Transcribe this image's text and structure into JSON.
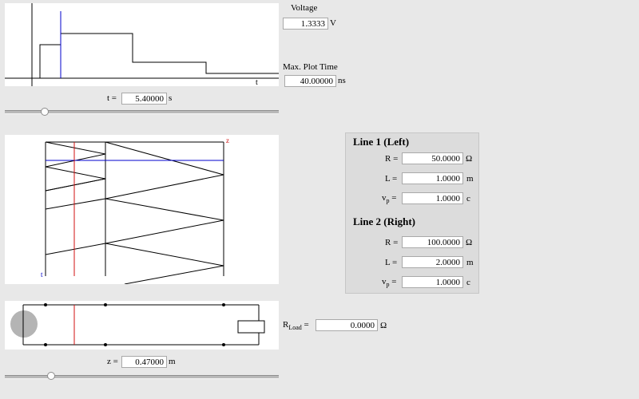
{
  "voltage": {
    "label": "Voltage",
    "value": "1.3333",
    "unit": "V"
  },
  "max_plot_time": {
    "label": "Max. Plot Time",
    "value": "40.00000",
    "unit": "ns"
  },
  "time": {
    "label": "t =",
    "value": "5.40000",
    "unit": "s",
    "slider_fraction": 0.146
  },
  "position": {
    "label": "z =",
    "value": "0.47000",
    "unit": "m",
    "slider_fraction": 0.168
  },
  "voltage_plot": {
    "axis_label": "t"
  },
  "bounce_diagram": {
    "z_label": "z",
    "t_label": "t"
  },
  "line1": {
    "heading": "Line 1 (Left)",
    "r_label": "R =",
    "r_value": "50.0000",
    "r_unit": "Ω",
    "l_label": "L =",
    "l_value": "1.0000",
    "l_unit": "m",
    "vp_label": "v",
    "vp_sub": "p",
    "vp_eq": " =",
    "vp_value": "1.0000",
    "vp_unit": "c"
  },
  "line2": {
    "heading": "Line 2 (Right)",
    "r_label": "R =",
    "r_value": "100.0000",
    "r_unit": "Ω",
    "l_label": "L =",
    "l_value": "2.0000",
    "l_unit": "m",
    "vp_label": "v",
    "vp_sub": "p",
    "vp_eq": " =",
    "vp_value": "1.0000",
    "vp_unit": "c"
  },
  "load": {
    "label": "R",
    "sub": "Load",
    "eq": " =",
    "value": "0.0000",
    "unit": "Ω"
  },
  "colors": {
    "marker_blue": "#0000cc",
    "marker_red": "#d01010",
    "source_gray": "#b4b4b4"
  }
}
